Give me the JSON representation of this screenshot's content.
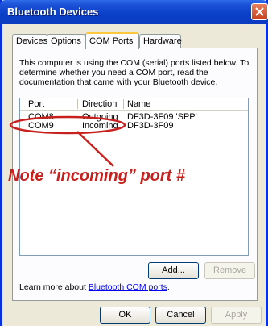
{
  "window": {
    "title": "Bluetooth Devices"
  },
  "tabs": [
    {
      "label": "Devices"
    },
    {
      "label": "Options"
    },
    {
      "label": "COM Ports",
      "active": true
    },
    {
      "label": "Hardware"
    }
  ],
  "description": "This computer is using the COM (serial) ports listed below. To determine whether you need a COM port, read the documentation that came with your Bluetooth device.",
  "table": {
    "headers": [
      "Port",
      "Direction",
      "Name"
    ],
    "rows": [
      [
        "COM8",
        "Outgoing",
        "DF3D-3F09 'SPP'"
      ],
      [
        "COM9",
        "Incoming",
        "DF3D-3F09"
      ]
    ]
  },
  "annotation": {
    "text": "Note “incoming” port #",
    "color": "#c8201c"
  },
  "buttons": {
    "add": "Add...",
    "remove": "Remove",
    "ok": "OK",
    "cancel": "Cancel",
    "apply": "Apply"
  },
  "learn_more": {
    "prefix": "Learn more about ",
    "link": "Bluetooth COM ports",
    "suffix": "."
  },
  "colors": {
    "titlebar": "#0a3fc8",
    "annotation": "#c8201c",
    "panel": "#ece9d8"
  }
}
